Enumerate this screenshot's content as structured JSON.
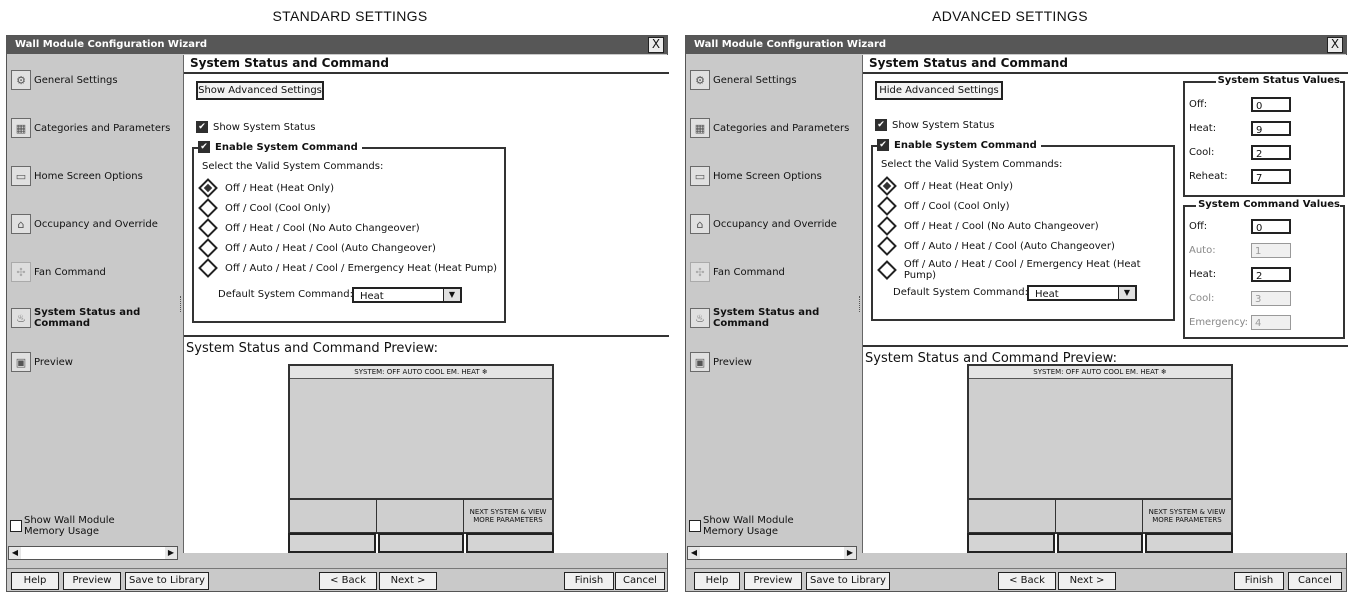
{
  "captions": {
    "left": "STANDARD SETTINGS",
    "right": "ADVANCED SETTINGS"
  },
  "window_title": "Wall Module Configuration Wizard",
  "close_glyph": "X",
  "sidebar_items": [
    {
      "label": "General Settings",
      "icon": "settings-icon"
    },
    {
      "label": "Categories and Parameters",
      "icon": "hierarchy-icon"
    },
    {
      "label": "Home Screen Options",
      "icon": "screen-icon"
    },
    {
      "label": "Occupancy and Override",
      "icon": "house-icon"
    },
    {
      "label": "Fan Command",
      "icon": "fan-icon"
    },
    {
      "label": "System Status and Command",
      "icon": "flame-icon"
    },
    {
      "label": "Preview",
      "icon": "preview-icon"
    }
  ],
  "memory_usage_label": "Show Wall Module Memory Usage",
  "section_title": "System Status and Command",
  "standard": {
    "toggle_label": "Show Advanced Settings"
  },
  "advanced": {
    "toggle_label": "Hide Advanced Settings"
  },
  "show_status_label": "Show System Status",
  "enable_command_label": "Enable System Command",
  "select_prompt": "Select the Valid System Commands:",
  "options": [
    {
      "label": "Off / Heat (Heat Only)",
      "selected": true
    },
    {
      "label": "Off / Cool (Cool Only)",
      "selected": false
    },
    {
      "label": "Off / Heat / Cool (No Auto Changeover)",
      "selected": false
    },
    {
      "label": "Off / Auto / Heat / Cool (Auto Changeover)",
      "selected": false
    },
    {
      "label": "Off / Auto / Heat / Cool / Emergency Heat (Heat Pump)",
      "selected": false
    }
  ],
  "default_command_label": "Default System Command:",
  "default_command_value": "Heat",
  "preview_heading": "System Status and Command Preview:",
  "device_status_text": "SYSTEM: OFF AUTO COOL EM. HEAT",
  "device_softkey_right": "NEXT SYSTEM & VIEW MORE PARAMETERS",
  "status_values_title": "System Status Values",
  "status_values": [
    {
      "label": "Off:",
      "value": "0"
    },
    {
      "label": "Heat:",
      "value": "9"
    },
    {
      "label": "Cool:",
      "value": "2"
    },
    {
      "label": "Reheat:",
      "value": "7"
    }
  ],
  "command_values_title": "System Command Values",
  "command_values": [
    {
      "label": "Off:",
      "value": "0",
      "enabled": true
    },
    {
      "label": "Auto:",
      "value": "1",
      "enabled": false
    },
    {
      "label": "Heat:",
      "value": "2",
      "enabled": true
    },
    {
      "label": "Cool:",
      "value": "3",
      "enabled": false
    },
    {
      "label": "Emergency:",
      "value": "4",
      "enabled": false
    }
  ],
  "footer": {
    "help": "Help",
    "preview": "Preview",
    "save": "Save to Library",
    "back": "< Back",
    "next": "Next >",
    "finish": "Finish",
    "cancel": "Cancel"
  },
  "colors": {
    "titlebar": "#575757",
    "panel": "#c9c9c9"
  }
}
